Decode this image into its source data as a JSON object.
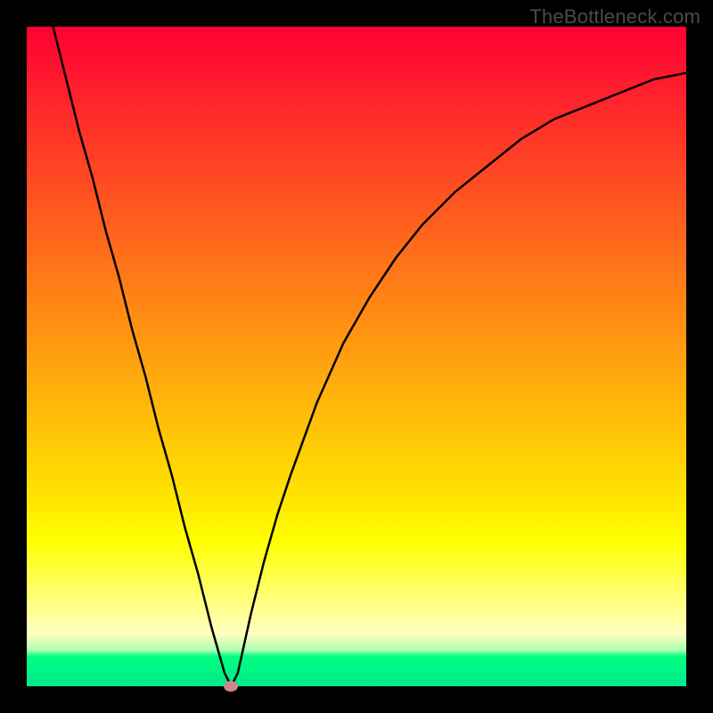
{
  "watermark": "TheBottleneck.com",
  "chart_data": {
    "type": "line",
    "title": "",
    "xlabel": "",
    "ylabel": "",
    "xlim": [
      0,
      100
    ],
    "ylim": [
      0,
      100
    ],
    "grid": false,
    "legend": false,
    "background": {
      "type": "vertical-gradient",
      "stops": [
        {
          "pos": 0,
          "color": "#ff0033"
        },
        {
          "pos": 50,
          "color": "#ff9911"
        },
        {
          "pos": 78,
          "color": "#ffff00"
        },
        {
          "pos": 95,
          "color": "#00ff80"
        },
        {
          "pos": 100,
          "color": "#00e98c"
        }
      ]
    },
    "series": [
      {
        "name": "bottleneck-curve",
        "color": "#000000",
        "x": [
          4,
          6,
          8,
          10,
          12,
          14,
          16,
          18,
          20,
          22,
          24,
          26,
          28,
          30,
          31,
          32,
          34,
          36,
          38,
          40,
          44,
          48,
          52,
          56,
          60,
          65,
          70,
          75,
          80,
          85,
          90,
          95,
          100
        ],
        "y": [
          100,
          92,
          84,
          77,
          69,
          62,
          54,
          47,
          39,
          32,
          24,
          17,
          9,
          2,
          0,
          2,
          11,
          19,
          26,
          32,
          43,
          52,
          59,
          65,
          70,
          75,
          79,
          83,
          86,
          88,
          90,
          92,
          93
        ]
      }
    ],
    "markers": [
      {
        "name": "minimum-point",
        "x": 31,
        "y": 0,
        "color": "#cc8888"
      }
    ]
  }
}
